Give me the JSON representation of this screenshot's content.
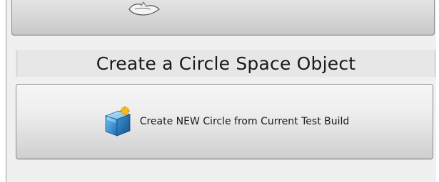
{
  "top_button": {
    "icon": "ship-icon"
  },
  "section": {
    "title": "Create a Circle Space Object"
  },
  "create_button": {
    "label": "Create NEW Circle from Current Test Build",
    "icon": "cube-icon"
  }
}
